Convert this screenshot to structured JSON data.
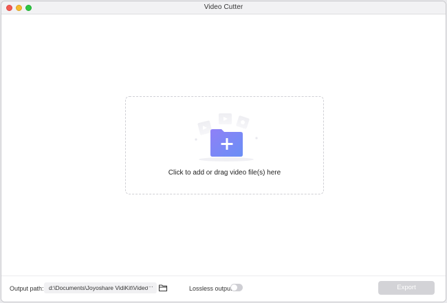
{
  "window": {
    "title": "Video Cutter"
  },
  "dropzone": {
    "prompt": "Click to add or drag video file(s) here"
  },
  "footer": {
    "output_label": "Output path:",
    "output_path": "d:\\Documents\\Joyoshare VidiKit\\Video",
    "more_label": "···",
    "lossless_label": "Lossless output:",
    "lossless_enabled": false,
    "export_label": "Export"
  },
  "colors": {
    "accent": "#7b86f5",
    "toggle_off": "#cfcfd4",
    "export_disabled": "#d3d3d7"
  },
  "icons": {
    "close": "close-icon",
    "minimize": "minimize-icon",
    "maximize": "maximize-icon",
    "add_folder": "add-folder-icon",
    "browse_folder": "folder-icon"
  }
}
